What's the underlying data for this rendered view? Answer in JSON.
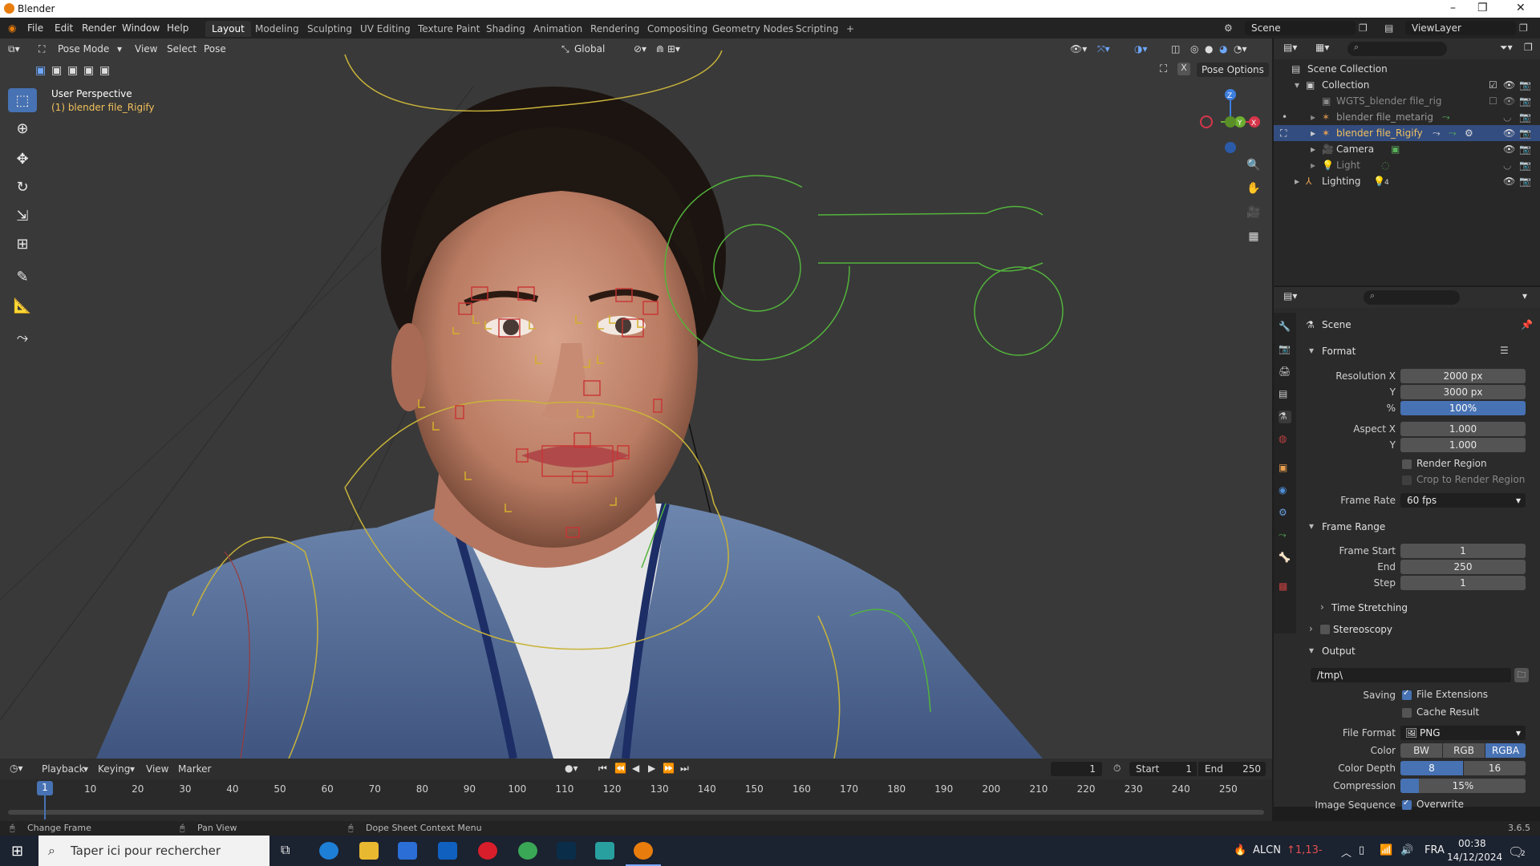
{
  "window": {
    "title": "Blender",
    "controls": [
      "–",
      "❐",
      "✕"
    ]
  },
  "menu": [
    "File",
    "Edit",
    "Render",
    "Window",
    "Help"
  ],
  "workspaces": [
    "Layout",
    "Modeling",
    "Sculpting",
    "UV Editing",
    "Texture Paint",
    "Shading",
    "Animation",
    "Rendering",
    "Compositing",
    "Geometry Nodes",
    "Scripting",
    "+"
  ],
  "active_workspace": "Layout",
  "scene": "Scene",
  "viewlayer": "ViewLayer",
  "viewport_header": {
    "mode": "Pose Mode",
    "menus": [
      "View",
      "Select",
      "Pose"
    ],
    "orientation": "Global",
    "pose_options": "Pose Options"
  },
  "viewport_overlay": {
    "perspective": "User Perspective",
    "object": "(1) blender file_Rigify"
  },
  "gizmo": {
    "z": "Z",
    "y": "Y",
    "x": "X"
  },
  "outliner": {
    "root": "Scene Collection",
    "items": [
      {
        "label": "Collection",
        "level": 1
      },
      {
        "label": "WGTS_blender file_rig",
        "level": 2
      },
      {
        "label": "blender file_metarig",
        "level": 2
      },
      {
        "label": "blender file_Rigify",
        "level": 2
      },
      {
        "label": "Camera",
        "level": 2
      },
      {
        "label": "Light",
        "level": 2
      },
      {
        "label": "Lighting",
        "level": 1
      }
    ],
    "lighting_count": "4"
  },
  "properties": {
    "context": "Scene",
    "format": {
      "title": "Format",
      "resolution_x_label": "Resolution X",
      "resolution_x": "2000 px",
      "y_label": "Y",
      "resolution_y": "3000 px",
      "percent_label": "%",
      "percent": "100%",
      "aspect_x_label": "Aspect X",
      "aspect_x": "1.000",
      "aspect_y_label": "Y",
      "aspect_y": "1.000",
      "render_region": "Render Region",
      "crop_region": "Crop to Render Region",
      "frame_rate_label": "Frame Rate",
      "frame_rate": "60 fps"
    },
    "frame_range": {
      "title": "Frame Range",
      "start_label": "Frame Start",
      "start": "1",
      "end_label": "End",
      "end": "250",
      "step_label": "Step",
      "step": "1"
    },
    "time_stretching": "Time Stretching",
    "stereoscopy": "Stereoscopy",
    "output": {
      "title": "Output",
      "path": "/tmp\\",
      "saving_label": "Saving",
      "file_extensions": "File Extensions",
      "cache_result": "Cache Result",
      "file_format_label": "File Format",
      "file_format": "PNG",
      "color_label": "Color",
      "color_options": [
        "BW",
        "RGB",
        "RGBA"
      ],
      "color_depth_label": "Color Depth",
      "color_depth_options": [
        "8",
        "16"
      ],
      "compression_label": "Compression",
      "compression": "15%",
      "compression_level": 0.15,
      "image_sequence_label": "Image Sequence",
      "overwrite": "Overwrite"
    }
  },
  "timeline": {
    "menus": [
      "Playback",
      "Keying",
      "View",
      "Marker"
    ],
    "current_frame": "1",
    "start_label": "Start",
    "start": "1",
    "end_label": "End",
    "end": "250",
    "ticks": [
      "1",
      "10",
      "20",
      "30",
      "40",
      "50",
      "60",
      "70",
      "80",
      "90",
      "100",
      "110",
      "120",
      "130",
      "140",
      "150",
      "160",
      "170",
      "180",
      "190",
      "200",
      "210",
      "220",
      "230",
      "240",
      "250"
    ]
  },
  "statusbar": {
    "items": [
      "Change Frame",
      "Pan View",
      "Dope Sheet Context Menu"
    ],
    "version": "3.6.5"
  },
  "taskbar": {
    "search_placeholder": "Taper ici pour rechercher",
    "tray_app": "ALCN",
    "tray_value": "↑1,13-",
    "lang": "FRA",
    "time": "00:38",
    "date": "14/12/2024",
    "notif": "2"
  }
}
